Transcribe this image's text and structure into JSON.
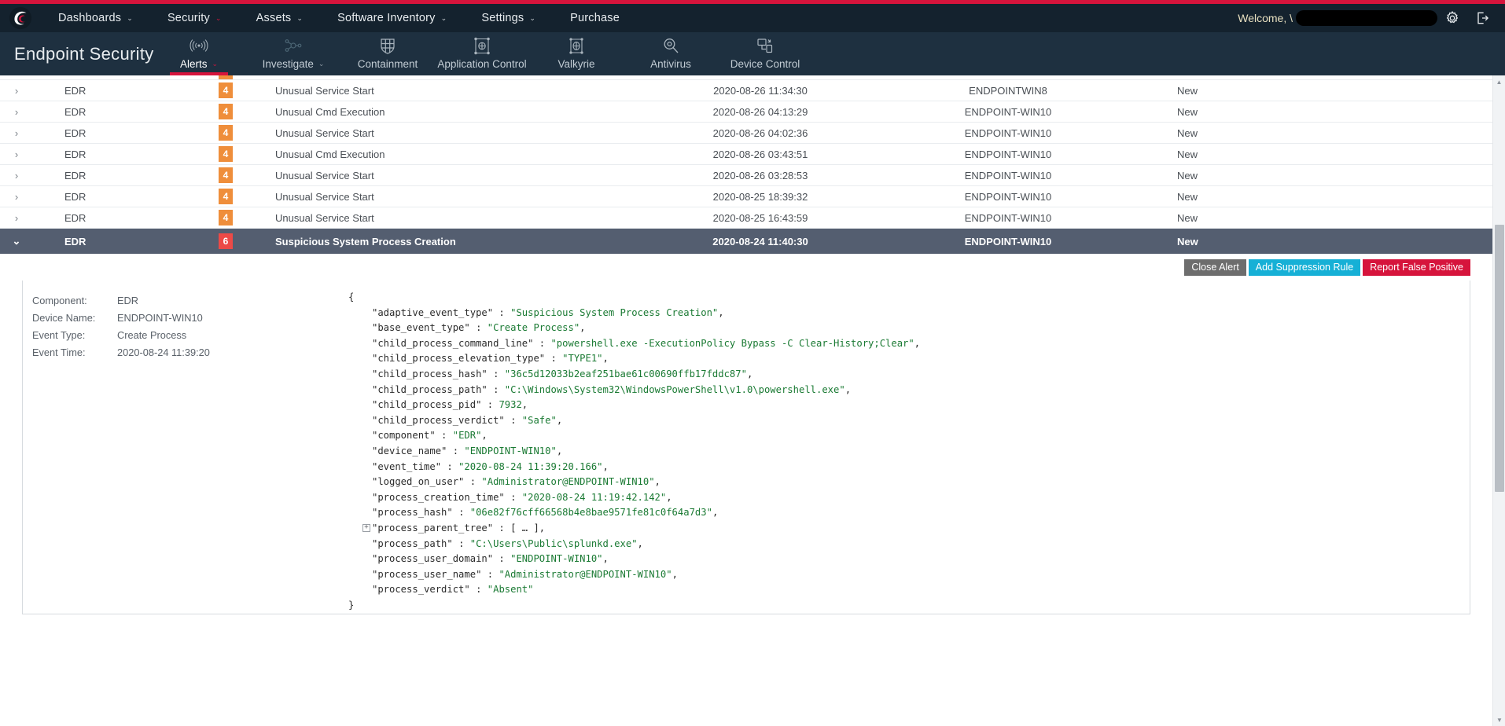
{
  "topnav": {
    "logo_icon": "comodo-logo-icon",
    "items": [
      {
        "label": "Dashboards",
        "caret": "⌄",
        "caret_red": false
      },
      {
        "label": "Security",
        "caret": "⌄",
        "caret_red": true
      },
      {
        "label": "Assets",
        "caret": "⌄",
        "caret_red": false
      },
      {
        "label": "Software Inventory",
        "caret": "⌄",
        "caret_red": false
      },
      {
        "label": "Settings",
        "caret": "⌄",
        "caret_red": false
      },
      {
        "label": "Purchase",
        "caret": "",
        "caret_red": false
      }
    ],
    "welcome_text": "Welcome, \\",
    "settings_icon": "gear-icon",
    "logout_icon": "logout-icon"
  },
  "subnav": {
    "brand": "Endpoint Security",
    "items": [
      {
        "label": "Alerts",
        "icon": "broadcast-icon",
        "active": true,
        "caret": "⌄"
      },
      {
        "label": "Investigate",
        "icon": "node-graph-icon",
        "active": false,
        "caret": "⌄"
      },
      {
        "label": "Containment",
        "icon": "shield-grid-icon",
        "active": false,
        "caret": ""
      },
      {
        "label": "Application Control",
        "icon": "app-control-icon",
        "active": false,
        "caret": ""
      },
      {
        "label": "Valkyrie",
        "icon": "valkyrie-icon",
        "active": false,
        "caret": ""
      },
      {
        "label": "Antivirus",
        "icon": "virus-magnifier-icon",
        "active": false,
        "caret": ""
      },
      {
        "label": "Device Control",
        "icon": "device-control-icon",
        "active": false,
        "caret": ""
      }
    ]
  },
  "alerts": {
    "rows": [
      {
        "expand": "›",
        "component": "EDR",
        "severity": "4",
        "severity_class": "sev-4",
        "name": "Unusual Service Start",
        "time": "2020-08-26 11:34:30",
        "device": "ENDPOINTWIN8",
        "status": "New",
        "selected": false
      },
      {
        "expand": "›",
        "component": "EDR",
        "severity": "4",
        "severity_class": "sev-4",
        "name": "Unusual Cmd Execution",
        "time": "2020-08-26 04:13:29",
        "device": "ENDPOINT-WIN10",
        "status": "New",
        "selected": false
      },
      {
        "expand": "›",
        "component": "EDR",
        "severity": "4",
        "severity_class": "sev-4",
        "name": "Unusual Service Start",
        "time": "2020-08-26 04:02:36",
        "device": "ENDPOINT-WIN10",
        "status": "New",
        "selected": false
      },
      {
        "expand": "›",
        "component": "EDR",
        "severity": "4",
        "severity_class": "sev-4",
        "name": "Unusual Cmd Execution",
        "time": "2020-08-26 03:43:51",
        "device": "ENDPOINT-WIN10",
        "status": "New",
        "selected": false
      },
      {
        "expand": "›",
        "component": "EDR",
        "severity": "4",
        "severity_class": "sev-4",
        "name": "Unusual Service Start",
        "time": "2020-08-26 03:28:53",
        "device": "ENDPOINT-WIN10",
        "status": "New",
        "selected": false
      },
      {
        "expand": "›",
        "component": "EDR",
        "severity": "4",
        "severity_class": "sev-4",
        "name": "Unusual Service Start",
        "time": "2020-08-25 18:39:32",
        "device": "ENDPOINT-WIN10",
        "status": "New",
        "selected": false
      },
      {
        "expand": "›",
        "component": "EDR",
        "severity": "4",
        "severity_class": "sev-4",
        "name": "Unusual Service Start",
        "time": "2020-08-25 16:43:59",
        "device": "ENDPOINT-WIN10",
        "status": "New",
        "selected": false
      },
      {
        "expand": "⌄",
        "component": "EDR",
        "severity": "6",
        "severity_class": "sev-6",
        "name": "Suspicious System Process Creation",
        "time": "2020-08-24 11:40:30",
        "device": "ENDPOINT-WIN10",
        "status": "New",
        "selected": true
      }
    ]
  },
  "detail": {
    "buttons": {
      "close_alert": "Close Alert",
      "add_suppression_rule": "Add Suppression Rule",
      "report_false_positive": "Report False Positive"
    },
    "meta": [
      {
        "key": "Component:",
        "value": "EDR"
      },
      {
        "key": "Device Name:",
        "value": "ENDPOINT-WIN10"
      },
      {
        "key": "Event Type:",
        "value": "Create Process"
      },
      {
        "key": "Event Time:",
        "value": "2020-08-24 11:39:20"
      }
    ],
    "json_open": "{",
    "json_close": "}",
    "json_fields": [
      {
        "key": "\"adaptive_event_type\"",
        "sep": " : ",
        "value": "\"Suspicious System Process Creation\"",
        "type": "str",
        "comma": ",",
        "toggle": ""
      },
      {
        "key": "\"base_event_type\"",
        "sep": " : ",
        "value": "\"Create Process\"",
        "type": "str",
        "comma": ",",
        "toggle": ""
      },
      {
        "key": "\"child_process_command_line\"",
        "sep": " : ",
        "value": "\"powershell.exe -ExecutionPolicy Bypass -C Clear-History;Clear\"",
        "type": "str",
        "comma": ",",
        "toggle": ""
      },
      {
        "key": "\"child_process_elevation_type\"",
        "sep": " : ",
        "value": "\"TYPE1\"",
        "type": "str",
        "comma": ",",
        "toggle": ""
      },
      {
        "key": "\"child_process_hash\"",
        "sep": " : ",
        "value": "\"36c5d12033b2eaf251bae61c00690ffb17fddc87\"",
        "type": "str",
        "comma": ",",
        "toggle": ""
      },
      {
        "key": "\"child_process_path\"",
        "sep": " : ",
        "value": "\"C:\\Windows\\System32\\WindowsPowerShell\\v1.0\\powershell.exe\"",
        "type": "str",
        "comma": ",",
        "toggle": ""
      },
      {
        "key": "\"child_process_pid\"",
        "sep": " : ",
        "value": "7932",
        "type": "num",
        "comma": ",",
        "toggle": ""
      },
      {
        "key": "\"child_process_verdict\"",
        "sep": " : ",
        "value": "\"Safe\"",
        "type": "str",
        "comma": ",",
        "toggle": ""
      },
      {
        "key": "\"component\"",
        "sep": " : ",
        "value": "\"EDR\"",
        "type": "str",
        "comma": ",",
        "toggle": ""
      },
      {
        "key": "\"device_name\"",
        "sep": " : ",
        "value": "\"ENDPOINT-WIN10\"",
        "type": "str",
        "comma": ",",
        "toggle": ""
      },
      {
        "key": "\"event_time\"",
        "sep": " : ",
        "value": "\"2020-08-24 11:39:20.166\"",
        "type": "str",
        "comma": ",",
        "toggle": ""
      },
      {
        "key": "\"logged_on_user\"",
        "sep": " : ",
        "value": "\"Administrator@ENDPOINT-WIN10\"",
        "type": "str",
        "comma": ",",
        "toggle": ""
      },
      {
        "key": "\"process_creation_time\"",
        "sep": " : ",
        "value": "\"2020-08-24 11:19:42.142\"",
        "type": "str",
        "comma": ",",
        "toggle": ""
      },
      {
        "key": "\"process_hash\"",
        "sep": " : ",
        "value": "\"06e82f76cff66568b4e8bae9571fe81c0f64a7d3\"",
        "type": "str",
        "comma": ",",
        "toggle": ""
      },
      {
        "key": "\"process_parent_tree\"",
        "sep": " : ",
        "value": "[ … ]",
        "type": "punct",
        "comma": ",",
        "toggle": "+"
      },
      {
        "key": "\"process_path\"",
        "sep": " : ",
        "value": "\"C:\\Users\\Public\\splunkd.exe\"",
        "type": "str",
        "comma": ",",
        "toggle": ""
      },
      {
        "key": "\"process_user_domain\"",
        "sep": " : ",
        "value": "\"ENDPOINT-WIN10\"",
        "type": "str",
        "comma": ",",
        "toggle": ""
      },
      {
        "key": "\"process_user_name\"",
        "sep": " : ",
        "value": "\"Administrator@ENDPOINT-WIN10\"",
        "type": "str",
        "comma": ",",
        "toggle": ""
      },
      {
        "key": "\"process_verdict\"",
        "sep": " : ",
        "value": "\"Absent\"",
        "type": "str",
        "comma": "",
        "toggle": ""
      }
    ]
  },
  "scrollbar": {
    "up": "▲",
    "down": "▼"
  }
}
